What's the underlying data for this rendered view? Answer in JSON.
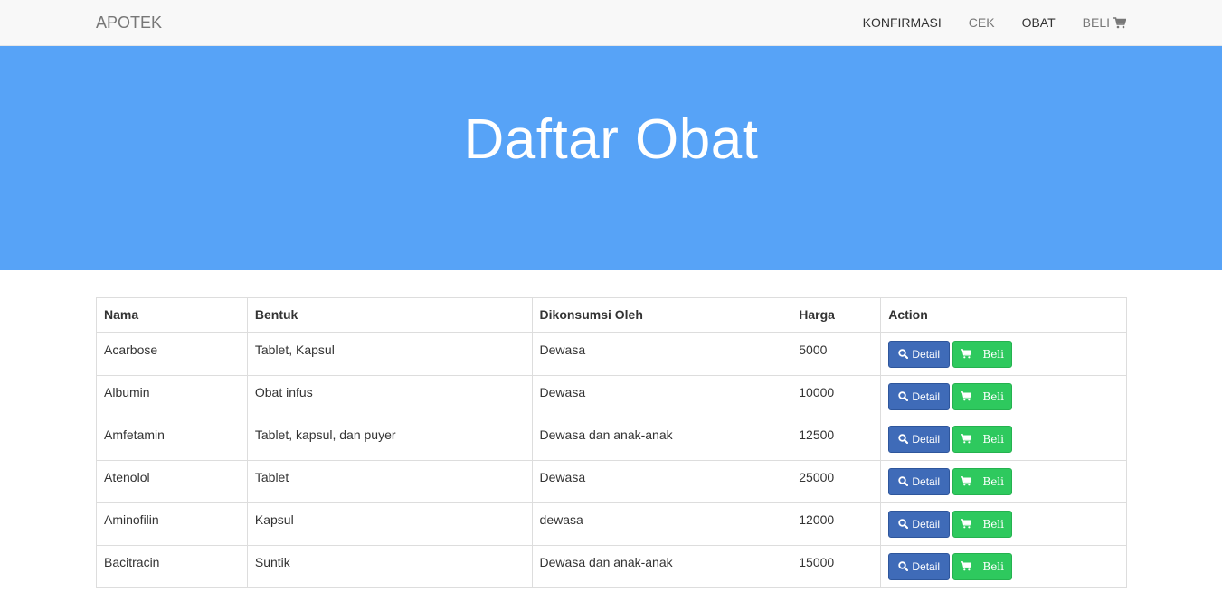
{
  "navbar": {
    "brand": "APOTEK",
    "items": [
      {
        "label": "KONFIRMASI"
      },
      {
        "label": "CEK"
      },
      {
        "label": "OBAT"
      },
      {
        "label": "BELI"
      }
    ]
  },
  "hero": {
    "title": "Daftar Obat"
  },
  "table": {
    "headers": [
      "Nama",
      "Bentuk",
      "Dikonsumsi Oleh",
      "Harga",
      "Action"
    ],
    "rows": [
      {
        "nama": "Acarbose",
        "bentuk": "Tablet, Kapsul",
        "dikonsumsi": "Dewasa",
        "harga": "5000"
      },
      {
        "nama": "Albumin",
        "bentuk": "Obat infus",
        "dikonsumsi": "Dewasa",
        "harga": "10000"
      },
      {
        "nama": "Amfetamin",
        "bentuk": "Tablet, kapsul, dan puyer",
        "dikonsumsi": "Dewasa dan anak-anak",
        "harga": "12500"
      },
      {
        "nama": "Atenolol",
        "bentuk": "Tablet",
        "dikonsumsi": "Dewasa",
        "harga": "25000"
      },
      {
        "nama": "Aminofilin",
        "bentuk": "Kapsul",
        "dikonsumsi": "dewasa",
        "harga": "12000"
      },
      {
        "nama": "Bacitracin",
        "bentuk": "Suntik",
        "dikonsumsi": "Dewasa dan anak-anak",
        "harga": "15000"
      }
    ],
    "detail_label": "Detail",
    "beli_label": "Beli"
  },
  "colors": {
    "hero_bg": "#57a3f7",
    "detail_btn": "#3f6bb8",
    "beli_btn": "#2ec95e"
  },
  "icons": {
    "cart": "cart-icon",
    "search": "search-icon"
  }
}
